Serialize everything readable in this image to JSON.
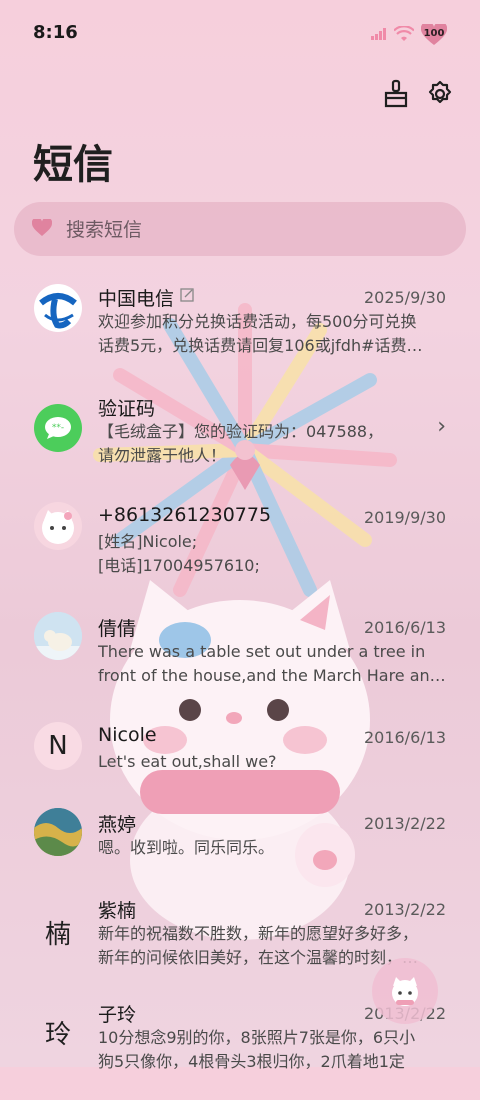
{
  "status_bar": {
    "time": "8:16",
    "battery": "100"
  },
  "header": {
    "title": "短信"
  },
  "search": {
    "placeholder": "搜索短信"
  },
  "messages": [
    {
      "name": "中国电信",
      "date": "2025/9/30",
      "line1": "欢迎参加积分兑换话费活动，每500分可兑换",
      "line2": "话费5元，兑换话费请回复106或jfdh#话费…"
    },
    {
      "name": "验证码",
      "date": "",
      "line1": "【毛绒盒子】您的验证码为：047588，",
      "line2": "请勿泄露于他人！"
    },
    {
      "name": "+8613261230775",
      "date": "2019/9/30",
      "line1": "[姓名]Nicole;",
      "line2": "[电话]17004957610;"
    },
    {
      "name": "倩倩",
      "date": "2016/6/13",
      "line1": "There was a table set out under a tree in",
      "line2": "front of the house,and the March Hare an…"
    },
    {
      "name": "Nicole",
      "date": "2016/6/13",
      "line1": "Let's eat out,shall we?",
      "line2": "",
      "avatar_letter": "N"
    },
    {
      "name": "燕婷",
      "date": "2013/2/22",
      "line1": "嗯。收到啦。同乐同乐。",
      "line2": ""
    },
    {
      "name": "紫楠",
      "date": "2013/2/22",
      "line1": "新年的祝福数不胜数，新年的愿望好多好多，",
      "line2": "新年的问候依旧美好，在这个温馨的时刻，…",
      "avatar_letter": "楠"
    },
    {
      "name": "子玲",
      "date": "2013/2/22",
      "line1": "10分想念9别的你，8张照片7张是你，6只小",
      "line2": "狗5只像你，4根骨头3根归你，2爪着地1定",
      "avatar_letter": "玲"
    }
  ],
  "colors": {
    "accent": "#e58aa8",
    "background": "#f3d3e0"
  }
}
